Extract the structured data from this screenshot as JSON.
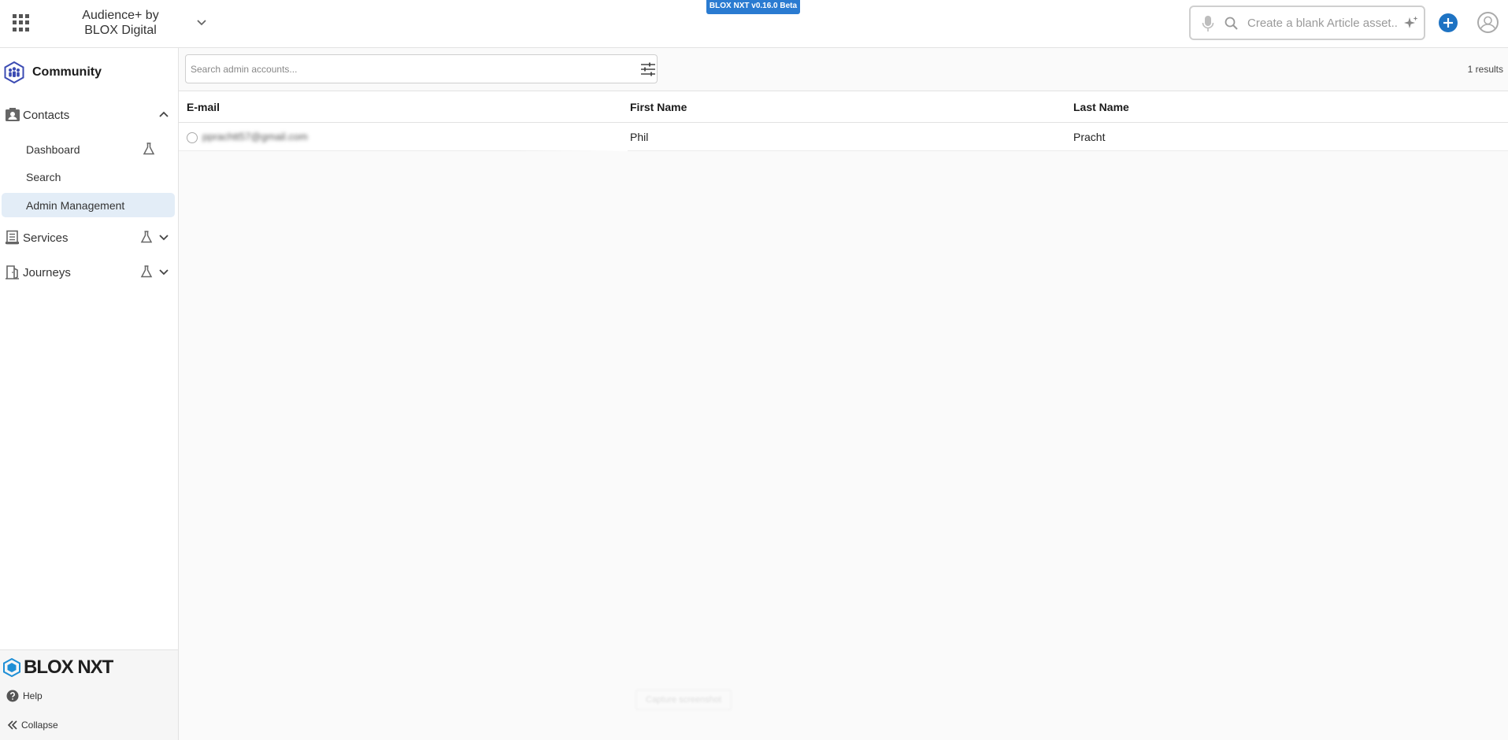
{
  "header": {
    "org_name": "Audience+ by BLOX Digital",
    "version_badge": "BLOX NXT v0.16.0 Beta",
    "ai_search_placeholder": "Create a blank Article asset...",
    "accent_color": "#1e73c3"
  },
  "sidebar": {
    "section_title": "Community",
    "groups": [
      {
        "label": "Contacts",
        "icon": "contacts-icon",
        "expanded": true,
        "items": [
          {
            "label": "Dashboard",
            "beta": true
          },
          {
            "label": "Search",
            "beta": false
          },
          {
            "label": "Admin Management",
            "beta": false,
            "active": true
          }
        ]
      },
      {
        "label": "Services",
        "icon": "services-icon",
        "expanded": false,
        "beta": true
      },
      {
        "label": "Journeys",
        "icon": "journeys-icon",
        "expanded": false,
        "beta": true
      }
    ],
    "footer": {
      "logo_text": "BLOX NXT",
      "help_label": "Help",
      "collapse_label": "Collapse"
    }
  },
  "main": {
    "search_placeholder": "Search admin accounts...",
    "results_count": "1 results",
    "columns": [
      "E-mail",
      "First Name",
      "Last Name"
    ],
    "rows": [
      {
        "email": "pprachtt57@gmail.com",
        "first_name": "Phil",
        "last_name": "Pracht"
      }
    ],
    "ghost_button_label": "Capture screenshot"
  }
}
